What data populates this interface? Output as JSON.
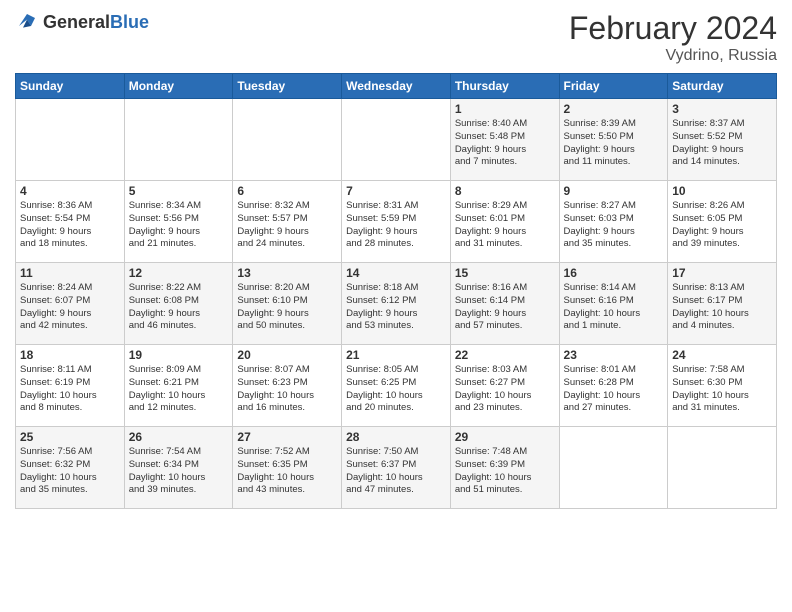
{
  "header": {
    "logo_general": "General",
    "logo_blue": "Blue",
    "month_year": "February 2024",
    "location": "Vydrino, Russia"
  },
  "weekdays": [
    "Sunday",
    "Monday",
    "Tuesday",
    "Wednesday",
    "Thursday",
    "Friday",
    "Saturday"
  ],
  "weeks": [
    [
      {
        "day": "",
        "info": ""
      },
      {
        "day": "",
        "info": ""
      },
      {
        "day": "",
        "info": ""
      },
      {
        "day": "",
        "info": ""
      },
      {
        "day": "1",
        "info": "Sunrise: 8:40 AM\nSunset: 5:48 PM\nDaylight: 9 hours\nand 7 minutes."
      },
      {
        "day": "2",
        "info": "Sunrise: 8:39 AM\nSunset: 5:50 PM\nDaylight: 9 hours\nand 11 minutes."
      },
      {
        "day": "3",
        "info": "Sunrise: 8:37 AM\nSunset: 5:52 PM\nDaylight: 9 hours\nand 14 minutes."
      }
    ],
    [
      {
        "day": "4",
        "info": "Sunrise: 8:36 AM\nSunset: 5:54 PM\nDaylight: 9 hours\nand 18 minutes."
      },
      {
        "day": "5",
        "info": "Sunrise: 8:34 AM\nSunset: 5:56 PM\nDaylight: 9 hours\nand 21 minutes."
      },
      {
        "day": "6",
        "info": "Sunrise: 8:32 AM\nSunset: 5:57 PM\nDaylight: 9 hours\nand 24 minutes."
      },
      {
        "day": "7",
        "info": "Sunrise: 8:31 AM\nSunset: 5:59 PM\nDaylight: 9 hours\nand 28 minutes."
      },
      {
        "day": "8",
        "info": "Sunrise: 8:29 AM\nSunset: 6:01 PM\nDaylight: 9 hours\nand 31 minutes."
      },
      {
        "day": "9",
        "info": "Sunrise: 8:27 AM\nSunset: 6:03 PM\nDaylight: 9 hours\nand 35 minutes."
      },
      {
        "day": "10",
        "info": "Sunrise: 8:26 AM\nSunset: 6:05 PM\nDaylight: 9 hours\nand 39 minutes."
      }
    ],
    [
      {
        "day": "11",
        "info": "Sunrise: 8:24 AM\nSunset: 6:07 PM\nDaylight: 9 hours\nand 42 minutes."
      },
      {
        "day": "12",
        "info": "Sunrise: 8:22 AM\nSunset: 6:08 PM\nDaylight: 9 hours\nand 46 minutes."
      },
      {
        "day": "13",
        "info": "Sunrise: 8:20 AM\nSunset: 6:10 PM\nDaylight: 9 hours\nand 50 minutes."
      },
      {
        "day": "14",
        "info": "Sunrise: 8:18 AM\nSunset: 6:12 PM\nDaylight: 9 hours\nand 53 minutes."
      },
      {
        "day": "15",
        "info": "Sunrise: 8:16 AM\nSunset: 6:14 PM\nDaylight: 9 hours\nand 57 minutes."
      },
      {
        "day": "16",
        "info": "Sunrise: 8:14 AM\nSunset: 6:16 PM\nDaylight: 10 hours\nand 1 minute."
      },
      {
        "day": "17",
        "info": "Sunrise: 8:13 AM\nSunset: 6:17 PM\nDaylight: 10 hours\nand 4 minutes."
      }
    ],
    [
      {
        "day": "18",
        "info": "Sunrise: 8:11 AM\nSunset: 6:19 PM\nDaylight: 10 hours\nand 8 minutes."
      },
      {
        "day": "19",
        "info": "Sunrise: 8:09 AM\nSunset: 6:21 PM\nDaylight: 10 hours\nand 12 minutes."
      },
      {
        "day": "20",
        "info": "Sunrise: 8:07 AM\nSunset: 6:23 PM\nDaylight: 10 hours\nand 16 minutes."
      },
      {
        "day": "21",
        "info": "Sunrise: 8:05 AM\nSunset: 6:25 PM\nDaylight: 10 hours\nand 20 minutes."
      },
      {
        "day": "22",
        "info": "Sunrise: 8:03 AM\nSunset: 6:27 PM\nDaylight: 10 hours\nand 23 minutes."
      },
      {
        "day": "23",
        "info": "Sunrise: 8:01 AM\nSunset: 6:28 PM\nDaylight: 10 hours\nand 27 minutes."
      },
      {
        "day": "24",
        "info": "Sunrise: 7:58 AM\nSunset: 6:30 PM\nDaylight: 10 hours\nand 31 minutes."
      }
    ],
    [
      {
        "day": "25",
        "info": "Sunrise: 7:56 AM\nSunset: 6:32 PM\nDaylight: 10 hours\nand 35 minutes."
      },
      {
        "day": "26",
        "info": "Sunrise: 7:54 AM\nSunset: 6:34 PM\nDaylight: 10 hours\nand 39 minutes."
      },
      {
        "day": "27",
        "info": "Sunrise: 7:52 AM\nSunset: 6:35 PM\nDaylight: 10 hours\nand 43 minutes."
      },
      {
        "day": "28",
        "info": "Sunrise: 7:50 AM\nSunset: 6:37 PM\nDaylight: 10 hours\nand 47 minutes."
      },
      {
        "day": "29",
        "info": "Sunrise: 7:48 AM\nSunset: 6:39 PM\nDaylight: 10 hours\nand 51 minutes."
      },
      {
        "day": "",
        "info": ""
      },
      {
        "day": "",
        "info": ""
      }
    ]
  ]
}
